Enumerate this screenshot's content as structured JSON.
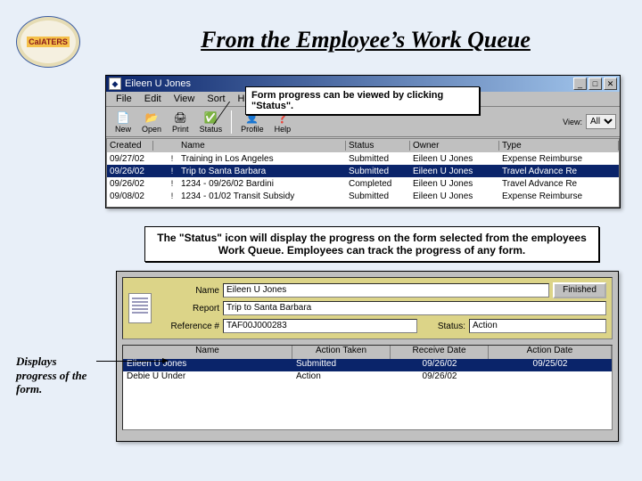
{
  "logo_text": "CalATERS",
  "heading": "From the Employee’s Work Queue",
  "callout_top": "Form progress can be viewed by clicking \"Status\".",
  "callout_mid": "The \"Status\" icon will display the progress on the form selected from the employees Work Queue. Employees can track the progress of any form.",
  "side_label": "Displays progress of the form.",
  "window": {
    "title": "Eileen U Jones",
    "menus": [
      "File",
      "Edit",
      "View",
      "Sort",
      "Help"
    ],
    "toolbar": {
      "new": "New",
      "open": "Open",
      "print": "Print",
      "status": "Status",
      "profile": "Profile",
      "help": "Help",
      "view_label": "View:",
      "view_value": "All"
    },
    "columns": [
      "Created",
      "",
      "",
      "Name",
      "Status",
      "Owner",
      "Type"
    ],
    "rows": [
      {
        "created": "09/27/02",
        "f1": "",
        "f2": "!",
        "name": "Training in Los Angeles",
        "status": "Submitted",
        "owner": "Eileen U Jones",
        "type": "Expense Reimburse"
      },
      {
        "created": "09/26/02",
        "f1": "",
        "f2": "!",
        "name": "Trip to Santa Barbara",
        "status": "Submitted",
        "owner": "Eileen U Jones",
        "type": "Travel Advance Re"
      },
      {
        "created": "09/26/02",
        "f1": "",
        "f2": "!",
        "name": "1234 - 09/26/02 Bardini",
        "status": "Completed",
        "owner": "Eileen U Jones",
        "type": "Travel Advance Re"
      },
      {
        "created": "09/08/02",
        "f1": "",
        "f2": "!",
        "name": "1234 - 01/02 Transit Subsidy",
        "status": "Submitted",
        "owner": "Eileen U Jones",
        "type": "Expense Reimburse"
      }
    ]
  },
  "status_panel": {
    "name_label": "Name",
    "name_value": "Eileen U Jones",
    "report_label": "Report",
    "report_value": "Trip to Santa Barbara",
    "ref_label": "Reference #",
    "ref_value": "TAF00J000283",
    "status_label": "Status:",
    "status_value": "Action",
    "finished": "Finished",
    "columns": [
      "Name",
      "Action Taken",
      "Receive Date",
      "Action Date"
    ],
    "rows": [
      {
        "name": "Eileen U Jones",
        "action": "Submitted",
        "receive": "09/26/02",
        "adate": "09/25/02"
      },
      {
        "name": "Debie U Under",
        "action": "Action",
        "receive": "09/26/02",
        "adate": ""
      }
    ]
  }
}
